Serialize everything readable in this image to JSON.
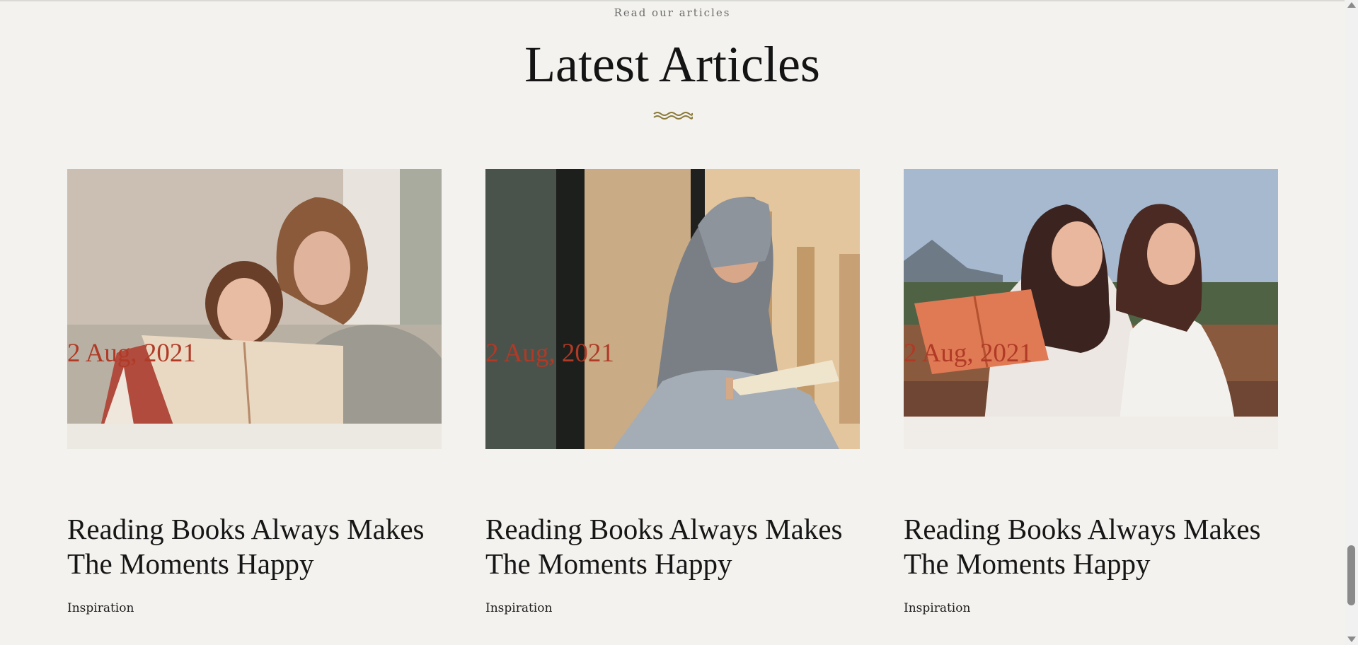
{
  "section": {
    "eyebrow": "Read our articles",
    "title": "Latest Articles",
    "divider_icon": "wave-divider-icon"
  },
  "articles": [
    {
      "image_alt": "Mother and daughter reading a book together",
      "date": "2 Aug, 2021",
      "title": "Reading Books Always Makes The Moments Happy",
      "category": "Inspiration"
    },
    {
      "image_alt": "Woman in headscarf reading a book by a window",
      "date": "2 Aug, 2021",
      "title": "Reading Books Always Makes The Moments Happy",
      "category": "Inspiration"
    },
    {
      "image_alt": "Two women sitting outdoors, one reading an orange book",
      "date": "2 Aug, 2021",
      "title": "Reading Books Always Makes The Moments Happy",
      "category": "Inspiration"
    }
  ],
  "colors": {
    "background": "#f3f2ee",
    "date_accent": "#b03a26",
    "divider": "#8a7a3a"
  }
}
